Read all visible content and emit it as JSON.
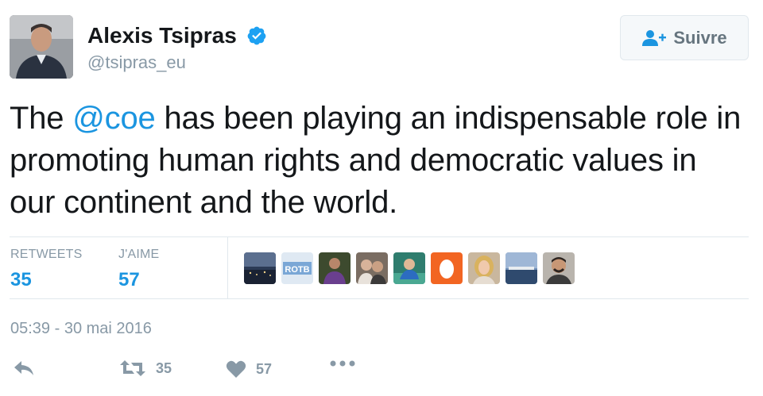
{
  "user": {
    "name": "Alexis Tsipras",
    "handle": "@tsipras_eu",
    "verified": true
  },
  "follow_button": {
    "label": "Suivre",
    "icon": "follow-person-plus-icon"
  },
  "tweet": {
    "text_before": "The ",
    "mention": "@coe",
    "text_after": " has been playing an indispensable role in promoting human rights and democratic values in our continent and the world."
  },
  "stats": {
    "retweets_label": "RETWEETS",
    "retweets_value": "35",
    "likes_label": "J'AIME",
    "likes_value": "57"
  },
  "likers": [
    {
      "icon": "liker-avatar-night-city"
    },
    {
      "icon": "liker-avatar-rotb-logo",
      "text": "ROTB"
    },
    {
      "icon": "liker-avatar-person-purple"
    },
    {
      "icon": "liker-avatar-couple"
    },
    {
      "icon": "liker-avatar-person-teal"
    },
    {
      "icon": "liker-avatar-egg"
    },
    {
      "icon": "liker-avatar-woman-blonde"
    },
    {
      "icon": "liker-avatar-harbor"
    },
    {
      "icon": "liker-avatar-man-smile"
    }
  ],
  "timestamp": "05:39 - 30 mai 2016",
  "actions": {
    "reply_icon": "reply-icon",
    "retweet_icon": "retweet-icon",
    "retweet_count": "35",
    "like_icon": "heart-icon",
    "like_count": "57",
    "more_icon": "more-dots-icon"
  },
  "colors": {
    "accent": "#1b95e0",
    "muted": "#8899a6",
    "text": "#14171a",
    "border": "#e1e8ed"
  }
}
